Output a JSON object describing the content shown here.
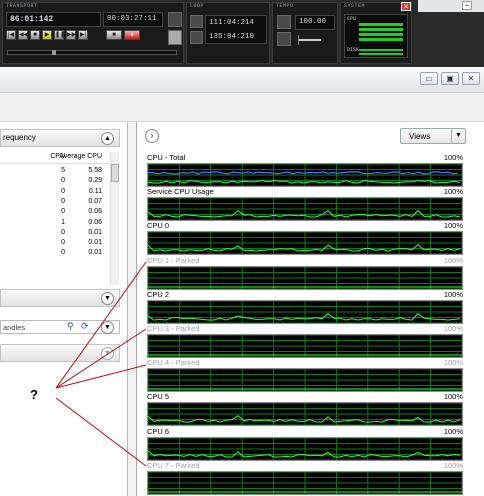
{
  "daw": {
    "transport": {
      "title": "TRANSPORT",
      "time": "86:01:142",
      "smpte": "00:03:27:11"
    },
    "loop": {
      "title": "LOOP",
      "start": "111:04:214",
      "end": "135:04:210"
    },
    "tempo": {
      "title": "TEMPO",
      "value": "100.00"
    },
    "system": {
      "title": "SYSTEM",
      "cpu_label": "CPU",
      "disk_label": "DISK"
    }
  },
  "left": {
    "header_title": "requency",
    "columns": [
      "CPU",
      "Average CPU"
    ],
    "rows": [
      [
        "5",
        "5.58"
      ],
      [
        "0",
        "0.29"
      ],
      [
        "0",
        "0.11"
      ],
      [
        "0",
        "0.07"
      ],
      [
        "0",
        "0.06"
      ],
      [
        "1",
        "0.06"
      ],
      [
        "0",
        "0.01"
      ],
      [
        "0",
        "0.01"
      ],
      [
        "0",
        "0.01"
      ]
    ],
    "handles_label": "andles"
  },
  "right": {
    "views_label": "Views",
    "graphs": [
      {
        "name": "CPU - Total",
        "pct": "100%",
        "parked": false
      },
      {
        "name": "Service CPU Usage",
        "pct": "100%",
        "parked": false
      },
      {
        "name": "CPU 0",
        "pct": "100%",
        "parked": false
      },
      {
        "name": "CPU 1 - Parked",
        "pct": "100%",
        "parked": true
      },
      {
        "name": "CPU 2",
        "pct": "100%",
        "parked": false
      },
      {
        "name": "CPU 3 - Parked",
        "pct": "100%",
        "parked": true
      },
      {
        "name": "CPU 4 - Parked",
        "pct": "100%",
        "parked": true
      },
      {
        "name": "CPU 5",
        "pct": "100%",
        "parked": false
      },
      {
        "name": "CPU 6",
        "pct": "100%",
        "parked": false
      },
      {
        "name": "CPU 7 - Parked",
        "pct": "100%",
        "parked": true
      }
    ]
  },
  "annotation": {
    "mark": "?",
    "color": "#b01010"
  },
  "colors": {
    "graph_bg": "#000000",
    "grid": "#0e7a1e",
    "line": "#36ff36",
    "total_line": "#5a6cff"
  }
}
